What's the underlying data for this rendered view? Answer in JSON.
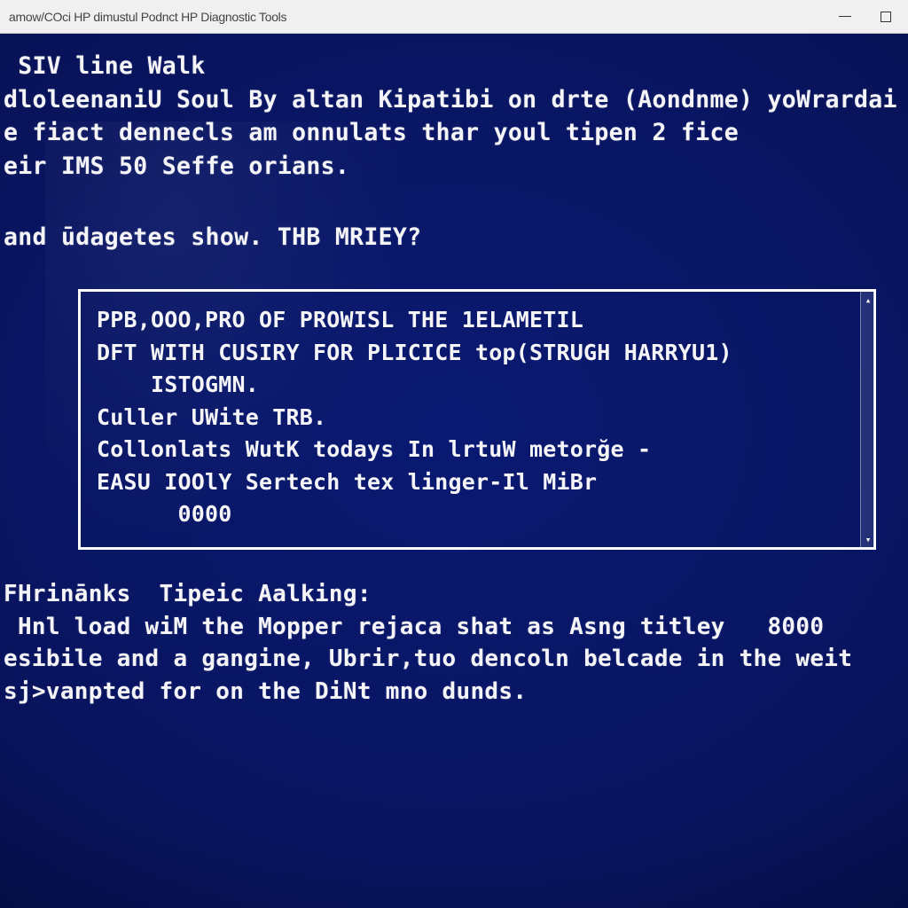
{
  "window": {
    "title": "amow/COci HP dimustul Podnct HP Diagnostic Tools"
  },
  "terminal": {
    "upper": {
      "l1": " SIV line Walk",
      "l2": "dloleenaniU Soul By altan Kipatibi on drte (Aondnme) yoWrardai",
      "l3": "e fiact dennecls am onnulats thar youl tipen 2 fice",
      "l4": "eir IMS 50 Seffe orians."
    },
    "prompt": "and ūdagetes show. THB MRIEY?",
    "box": {
      "l1": "PPB,OOO,PRO OF PROWISL THE 1ELAMETIL",
      "l2": "DFT WITH CUSIRY FOR PLICICE top(STRUGH HARRYU1)",
      "l3": "    ISTOGMN.",
      "l4": "",
      "l5": "Culler UWite TRB.",
      "l6": "Collonlats WutK todays In lrtuW metorğe -",
      "l7": "EASU IOOlY Sertech tex linger-Il MiBr",
      "l8": "",
      "l9": "      0000"
    },
    "lower": {
      "l1": "FHrinānks  Tipeic Aalking:",
      "l2": "",
      "l3": " Hnl load wiM the Mopper rejaca shat as Asng titley   8000",
      "l4": "esibile and a gangine, Ubrir,tuo dencoln belcade in the weit",
      "l5": "sj>vanpted for on the DiNt mno dunds."
    }
  }
}
